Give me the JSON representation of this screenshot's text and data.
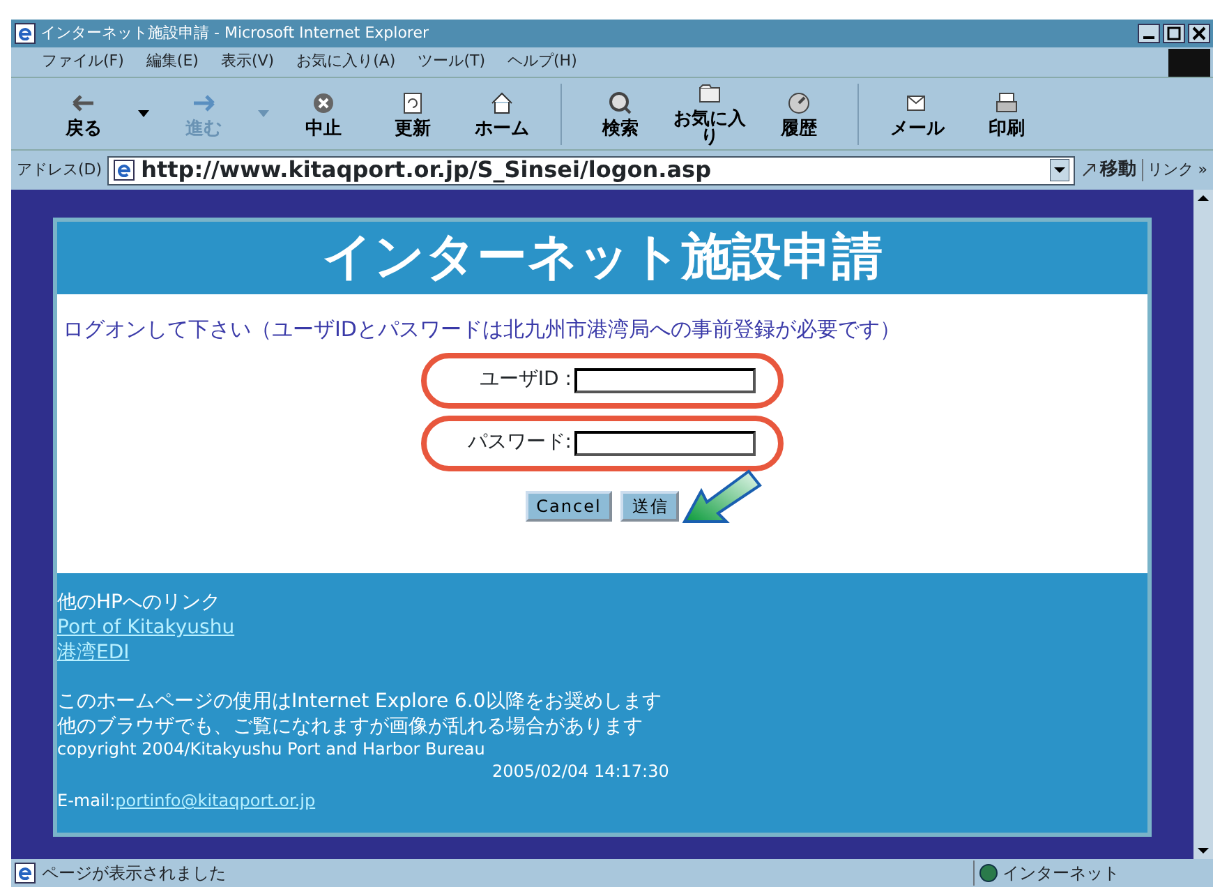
{
  "window": {
    "title": "インターネット施設申請 - Microsoft Internet Explorer"
  },
  "menu": [
    "ファイル(F)",
    "編集(E)",
    "表示(V)",
    "お気に入り(A)",
    "ツール(T)",
    "ヘルプ(H)"
  ],
  "toolbar": [
    {
      "label": "戻る",
      "dropdown": true,
      "disabled": false
    },
    {
      "label": "進む",
      "dropdown": true,
      "disabled": true
    },
    {
      "label": "中止",
      "dropdown": false,
      "disabled": false
    },
    {
      "label": "更新",
      "dropdown": false,
      "disabled": false
    },
    {
      "label": "ホーム",
      "dropdown": false,
      "disabled": false
    },
    {
      "label": "検索",
      "dropdown": false,
      "disabled": false
    },
    {
      "label": "お気に入り",
      "dropdown": false,
      "disabled": false
    },
    {
      "label": "履歴",
      "dropdown": false,
      "disabled": false
    },
    {
      "label": "メール",
      "dropdown": false,
      "disabled": false
    },
    {
      "label": "印刷",
      "dropdown": false,
      "disabled": false
    }
  ],
  "address": {
    "label": "アドレス(D)",
    "value": "http://www.kitaqport.or.jp/S_Sinsei/logon.asp",
    "go": "移動",
    "links": "リンク »"
  },
  "page": {
    "heading": "インターネット施設申請",
    "instruction": "ログオンして下さい（ユーザIDとパスワードは北九州市港湾局への事前登録が必要です）",
    "fields": [
      {
        "label": "ユーザID :",
        "highlighted": true
      },
      {
        "label": "パスワード:",
        "highlighted": true
      }
    ],
    "buttons": [
      {
        "label": "Cancel",
        "pointed": false
      },
      {
        "label": "送信",
        "pointed": true
      }
    ],
    "links_heading": "他のHPへのリンク",
    "links": [
      "Port of Kitakyushu",
      "港湾EDI"
    ],
    "notes": [
      "このホームページの使用はInternet Explore 6.0以降をお奨めします",
      "他のブラウザでも、ご覧になれますが画像が乱れる場合があります"
    ],
    "copyright": "copyright 2004/Kitakyushu Port and Harbor Bureau",
    "timestamp": "2005/02/04 14:17:30",
    "email_label": "E-mail:",
    "email": "portinfo@kitaqport.or.jp"
  },
  "status_bar": {
    "text": "ページが表示されました",
    "zone": "インターネット"
  }
}
